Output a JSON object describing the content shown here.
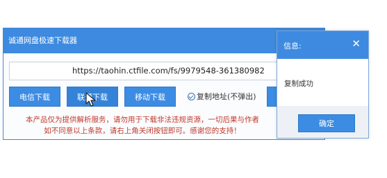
{
  "main_window": {
    "title": "诚通网盘极速下载器",
    "close_label": "×",
    "url_value": "https://taohin.ctfile.com/fs/9979548-361380982",
    "buttons": {
      "dianxin": "电信下载",
      "liantong": "联通下载",
      "yidong": "移动下载"
    },
    "copy_checkbox_label": "复制地址(不弹出)",
    "notice_line1": "本产品仅为提供解析服务，请勿用于下载非法违规资源，一切后果与作者",
    "notice_line2": "如不同意以上条款，请右上角关闭按钮即可。感谢您的支持！"
  },
  "info_dialog": {
    "title": "信息:",
    "close_label": "✕",
    "message": "复制成功",
    "ok_label": "确定"
  },
  "colors": {
    "accent": "#3d8ae0",
    "button": "#3c8ce3",
    "notice_text": "#c0392b"
  }
}
